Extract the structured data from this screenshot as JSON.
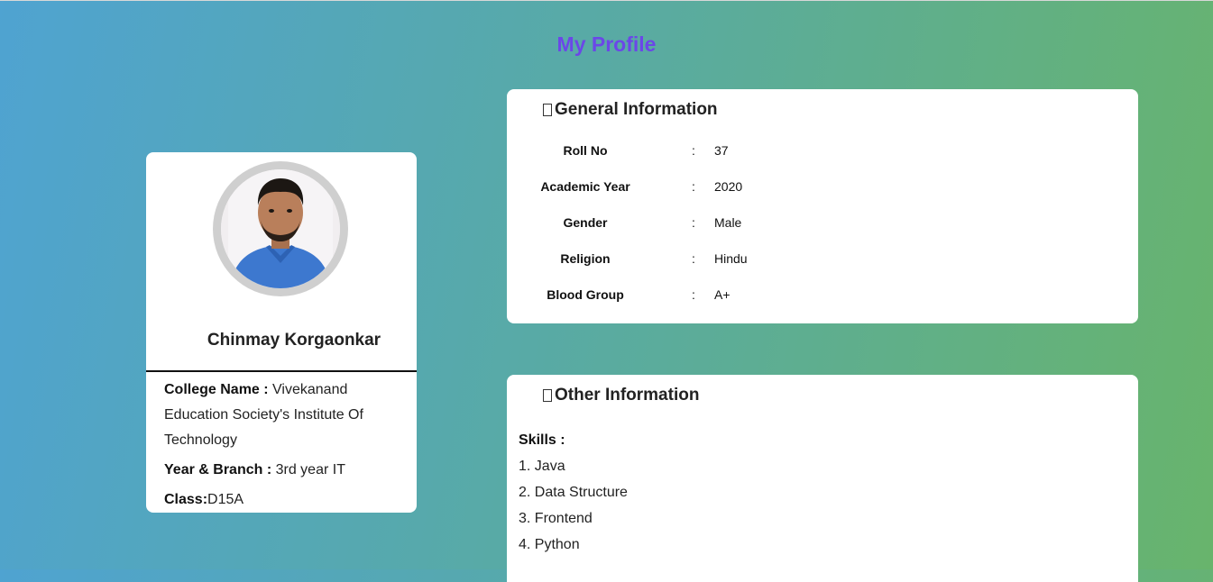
{
  "page": {
    "title": "My Profile"
  },
  "profile": {
    "name": "Chinmay Korgaonkar",
    "college_label": "College Name :",
    "college_value": "Vivekanand Education Society's Institute Of Technology",
    "year_label": "Year & Branch :",
    "year_value": "3rd year IT",
    "class_label": "Class:",
    "class_value": "D15A"
  },
  "general": {
    "title": "General Information",
    "rows": [
      {
        "label": "Roll No",
        "sep": ":",
        "value": "37"
      },
      {
        "label": "Academic Year",
        "sep": ":",
        "value": "2020"
      },
      {
        "label": "Gender",
        "sep": ":",
        "value": "Male"
      },
      {
        "label": "Religion",
        "sep": ":",
        "value": "Hindu"
      },
      {
        "label": "Blood Group",
        "sep": ":",
        "value": "A+"
      }
    ]
  },
  "other": {
    "title": "Other Information",
    "skills_label": "Skills :",
    "skills": [
      "1. Java",
      "2. Data Structure",
      "3. Frontend",
      "4. Python"
    ]
  },
  "colors": {
    "title": "#6b47e8",
    "bg_start": "#4fa3d1",
    "bg_end": "#68b46c"
  },
  "icons": {
    "card_title_icon": "square-glyph-icon"
  }
}
